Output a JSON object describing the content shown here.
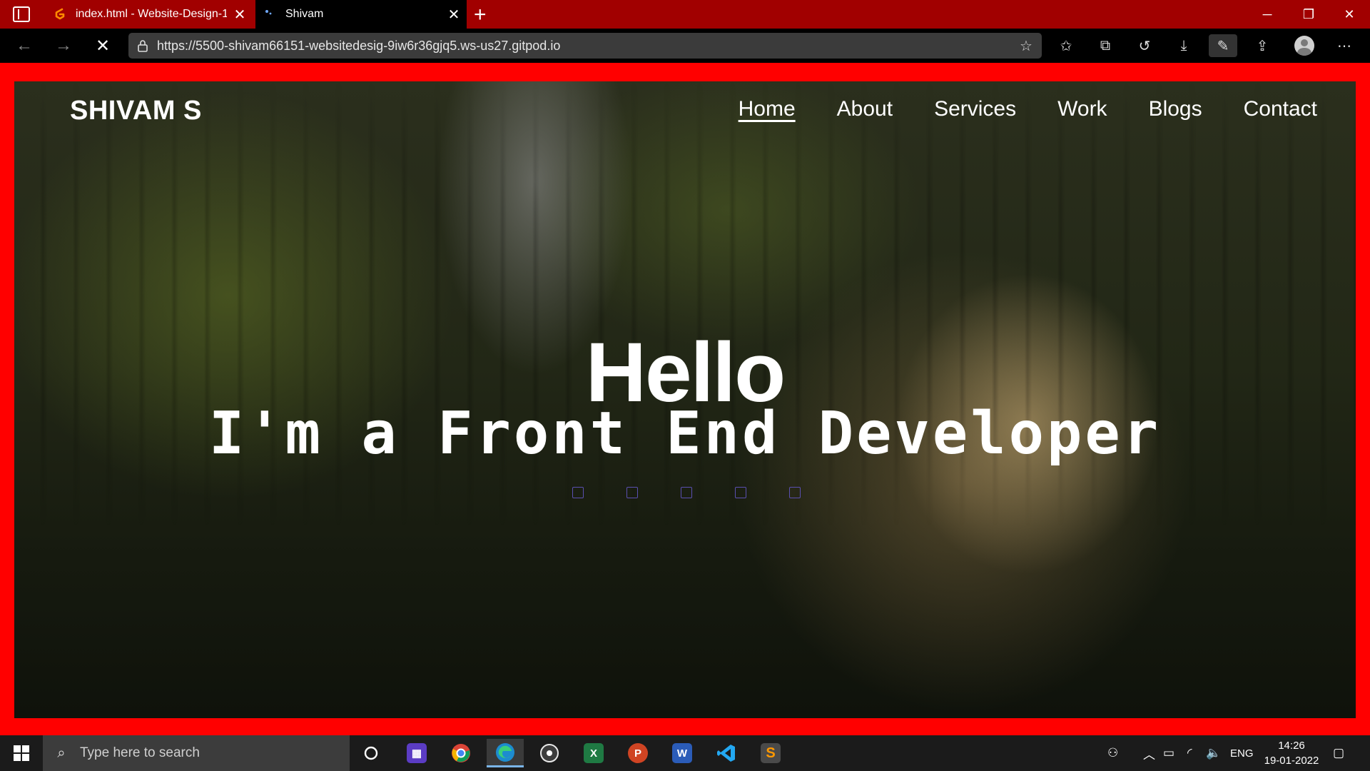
{
  "browser": {
    "tabs": [
      {
        "title": "index.html - Website-Design-1 -",
        "active": false
      },
      {
        "title": "Shivam",
        "active": true
      }
    ],
    "url": "https://5500-shivam66151-websitedesig-9iw6r36gjq5.ws-us27.gitpod.io"
  },
  "site": {
    "logo": "SHIVAM S",
    "nav": [
      "Home",
      "About",
      "Services",
      "Work",
      "Blogs",
      "Contact"
    ],
    "current_nav": "Home",
    "hero": {
      "greeting": "Hello",
      "subtitle": "I'm a Front End Developer"
    }
  },
  "taskbar": {
    "search_placeholder": "Type here to search",
    "language": "ENG",
    "time": "14:26",
    "date": "19-01-2022"
  },
  "colors": {
    "frame_border": "#ff0000",
    "tab_strip": "#a10000"
  }
}
